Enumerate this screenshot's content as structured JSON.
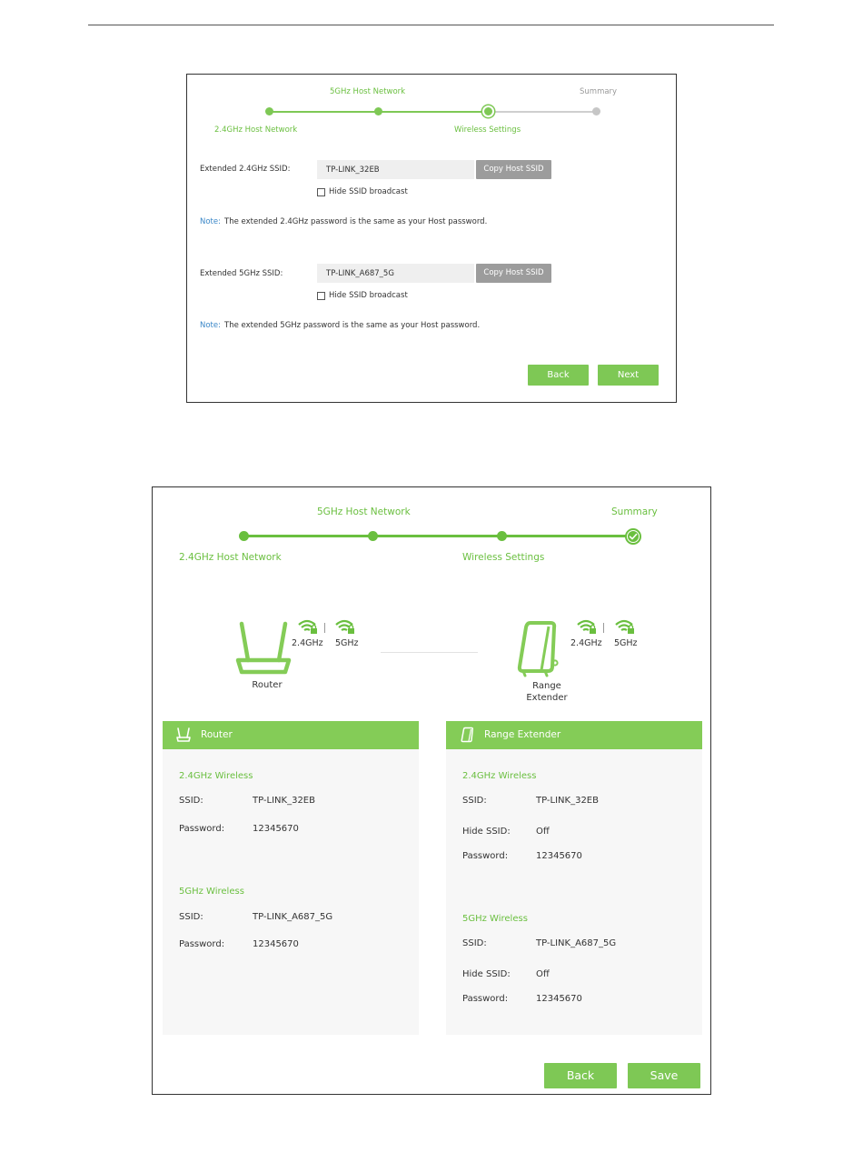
{
  "wizard_step3": {
    "steps": {
      "host_24": "2.4GHz Host Network",
      "host_5": "5GHz Host Network",
      "wireless_settings": "Wireless Settings",
      "summary": "Summary"
    },
    "ssid_24": {
      "label": "Extended 2.4GHz SSID:",
      "value": "TP-LINK_32EB",
      "copy_button": "Copy Host SSID",
      "hide_label": "Hide SSID broadcast",
      "note_label": "Note:",
      "note_text": "The extended 2.4GHz password is the same as your Host password."
    },
    "ssid_5": {
      "label": "Extended 5GHz SSID:",
      "value": "TP-LINK_A687_5G",
      "copy_button": "Copy Host SSID",
      "hide_label": "Hide SSID broadcast",
      "note_label": "Note:",
      "note_text": "The extended 5GHz password is the same as your Host password."
    },
    "back_button": "Back",
    "next_button": "Next"
  },
  "wizard_summary": {
    "steps": {
      "host_24": "2.4GHz Host Network",
      "host_5": "5GHz Host Network",
      "wireless_settings": "Wireless Settings",
      "summary": "Summary"
    },
    "diagram": {
      "router_label": "Router",
      "extender_label_line1": "Range",
      "extender_label_line2": "Extender",
      "band_24": "2.4GHz",
      "band_5": "5GHz"
    },
    "router_card": {
      "title": "Router",
      "sec_24": "2.4GHz Wireless",
      "ssid_key": "SSID:",
      "ssid_24": "TP-LINK_32EB",
      "password_key": "Password:",
      "password_24": "12345670",
      "sec_5": "5GHz Wireless",
      "ssid_5": "TP-LINK_A687_5G",
      "password_5": "12345670"
    },
    "extender_card": {
      "title": "Range Extender",
      "sec_24": "2.4GHz Wireless",
      "ssid_key": "SSID:",
      "ssid_24": "TP-LINK_32EB",
      "hide_key": "Hide SSID:",
      "hide_24": "Off",
      "password_key": "Password:",
      "password_24": "12345670",
      "sec_5": "5GHz Wireless",
      "ssid_5": "TP-LINK_A687_5G",
      "hide_5": "Off",
      "password_5": "12345670"
    },
    "back_button": "Back",
    "save_button": "Save"
  },
  "colors": {
    "accent": "#7ec855",
    "accent_text": "#6abf3f",
    "note": "#3a87c8",
    "copy_button": "#9c9c9c"
  },
  "icons": [
    "wifi-lock-icon",
    "router-icon",
    "range-extender-icon",
    "check-circle-icon"
  ]
}
